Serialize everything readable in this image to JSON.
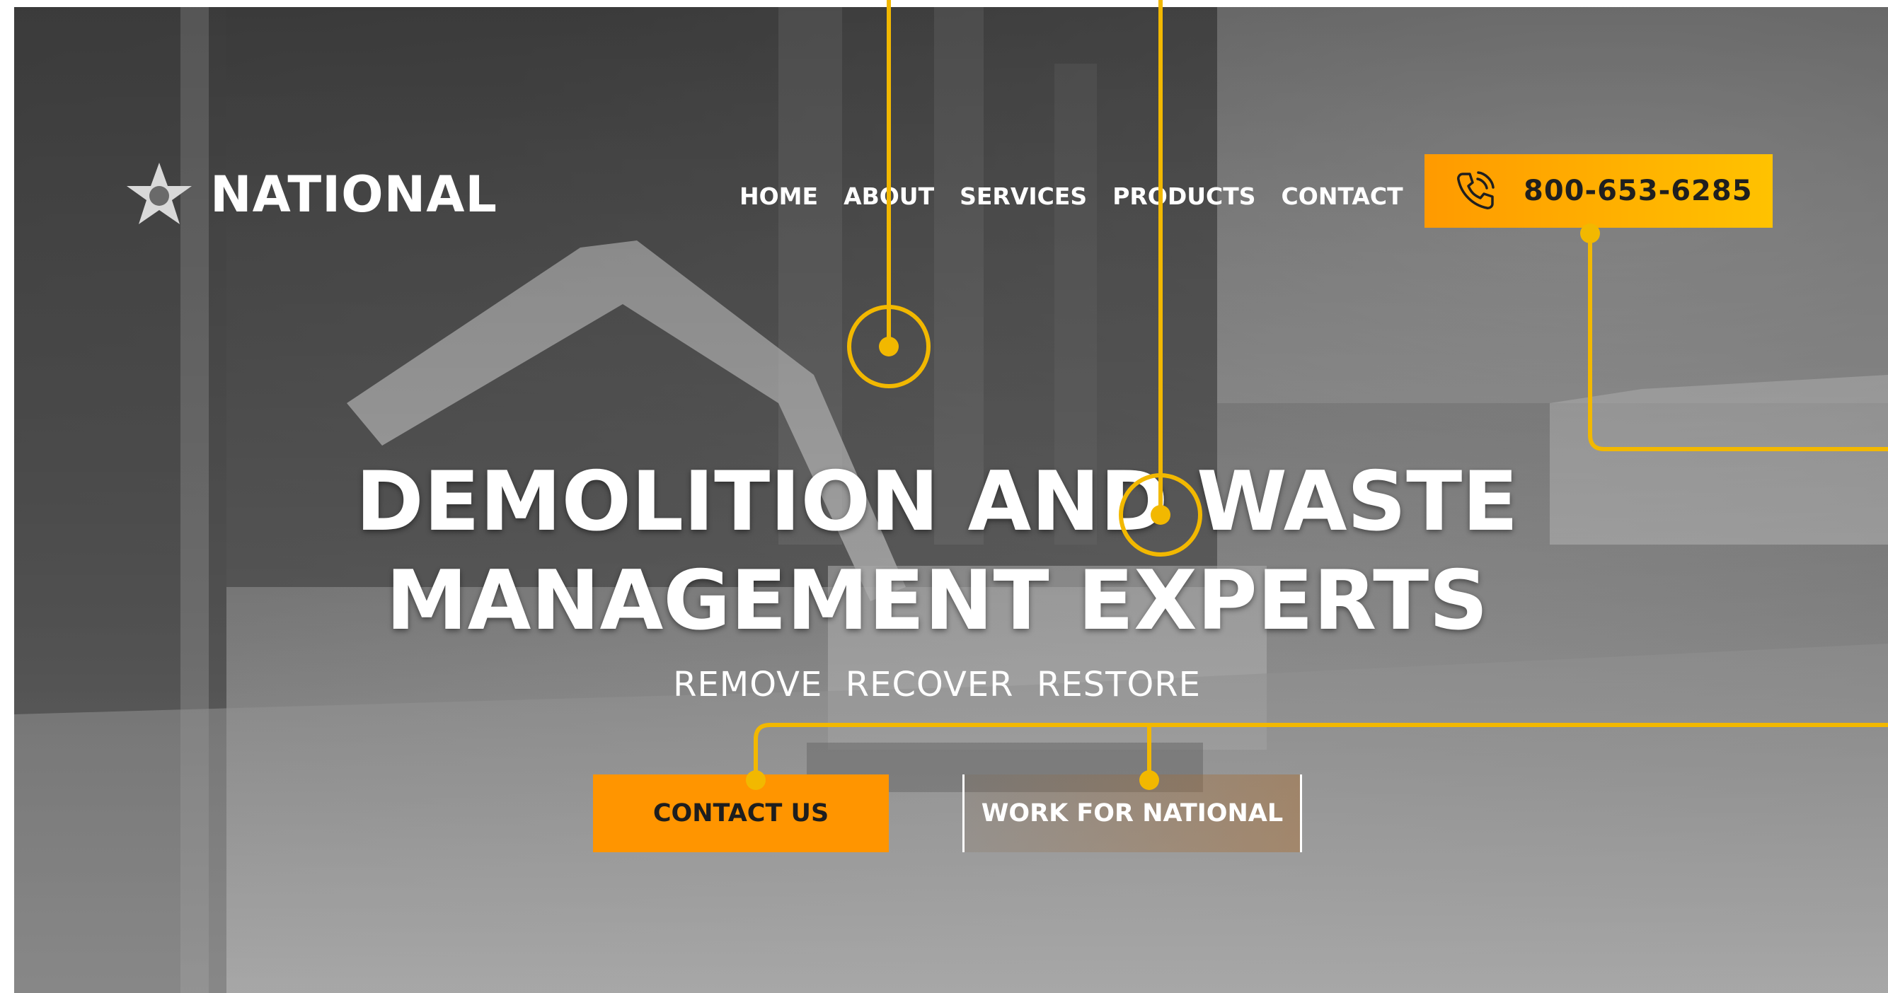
{
  "brand": {
    "logo_text": "NATIONAL"
  },
  "nav": {
    "items": [
      {
        "label": "HOME"
      },
      {
        "label": "ABOUT"
      },
      {
        "label": "SERVICES"
      },
      {
        "label": "PRODUCTS"
      },
      {
        "label": "CONTACT"
      }
    ]
  },
  "phone": {
    "number": "800-653-6285",
    "icon": "phone-icon"
  },
  "hero": {
    "headline_line1": "DEMOLITION AND WASTE",
    "headline_line2": "MANAGEMENT EXPERTS",
    "tagline": "REMOVE  RECOVER  RESTORE"
  },
  "buttons": {
    "contact_label": "CONTACT US",
    "work_label": "WORK FOR NATIONAL"
  },
  "colors": {
    "accent": "#ff9500",
    "annotation": "#f2b800",
    "text_light": "#ffffff",
    "text_dark": "#1e1e1e"
  }
}
